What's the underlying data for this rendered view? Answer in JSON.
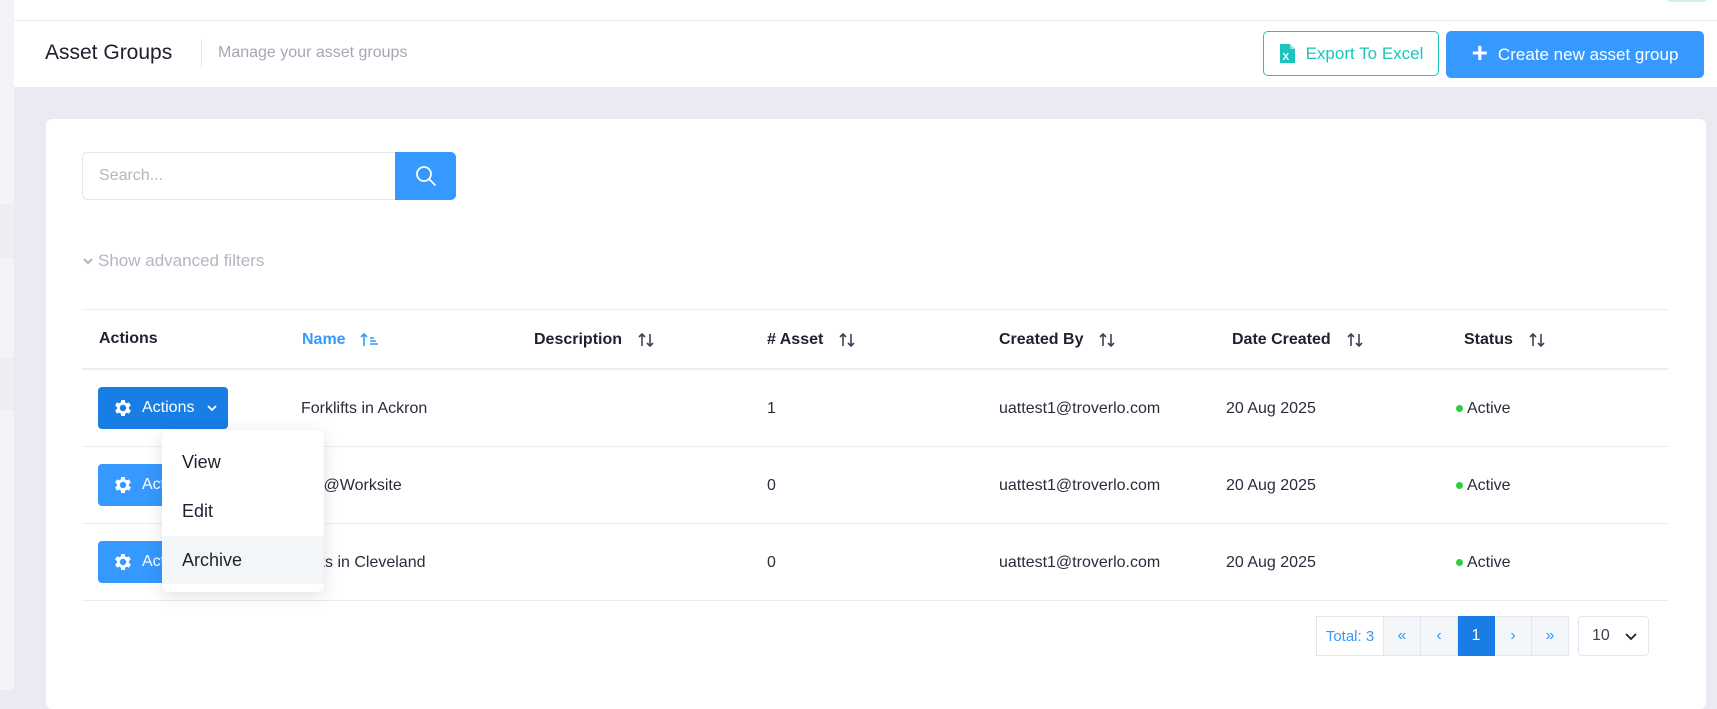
{
  "header": {
    "title": "Asset Groups",
    "subtitle": "Manage your asset groups",
    "export_label": "Export To Excel",
    "create_label": "Create new asset group"
  },
  "search": {
    "placeholder": "Search..."
  },
  "filters": {
    "toggle_label": "Show advanced filters"
  },
  "table": {
    "columns": [
      "Actions",
      "Name",
      "Description",
      "# Asset",
      "Created By",
      "Date Created",
      "Status"
    ],
    "rows": [
      {
        "name": "Forklifts in Ackron",
        "description": "",
        "assets": "1",
        "created_by": "uattest1@troverlo.com",
        "date_created": "20 Aug 2025",
        "status": "Active"
      },
      {
        "name": "ls@Worksite",
        "description": "",
        "assets": "0",
        "created_by": "uattest1@troverlo.com",
        "date_created": "20 Aug 2025",
        "status": "Active"
      },
      {
        "name": "cks in Cleveland",
        "description": "",
        "assets": "0",
        "created_by": "uattest1@troverlo.com",
        "date_created": "20 Aug 2025",
        "status": "Active"
      }
    ],
    "actions_label": "Actions",
    "actions_label_truncated": "Act"
  },
  "dropdown": {
    "items": [
      "View",
      "Edit",
      "Archive"
    ]
  },
  "pagination": {
    "total_label": "Total: 3",
    "current_page": "1",
    "first_icon": "«",
    "prev_icon": "‹",
    "next_icon": "›",
    "last_icon": "»",
    "page_size": "10"
  },
  "colors": {
    "primary": "#3699ff",
    "primary_dark": "#187de4",
    "success": "#1bc5bd",
    "status_active": "#2ecc40"
  },
  "icons": [
    "excel-icon",
    "plus-icon",
    "search-icon",
    "chevron-down-icon",
    "gear-icon",
    "sort-icon",
    "sort-asc-icon"
  ]
}
